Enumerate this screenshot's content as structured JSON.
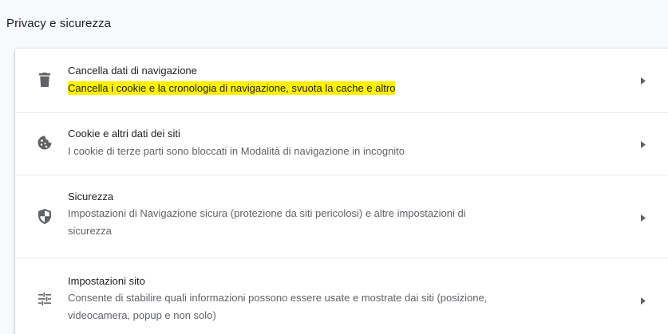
{
  "section": {
    "title": "Privacy e sicurezza"
  },
  "rows": [
    {
      "title": "Cancella dati di navigazione",
      "subtitle": "Cancella i cookie e la cronologia di navigazione, svuota la cache e altro",
      "icon": "trash-icon",
      "highlighted": true
    },
    {
      "title": "Cookie e altri dati dei siti",
      "subtitle": "I cookie di terze parti sono bloccati in Modalità di navigazione in incognito",
      "icon": "cookie-icon"
    },
    {
      "title": "Sicurezza",
      "subtitle_line1": "Impostazioni di Navigazione sicura (protezione da siti pericolosi) e altre impostazioni di",
      "subtitle_line2": "sicurezza",
      "icon": "shield-icon"
    },
    {
      "title": "Impostazioni sito",
      "subtitle_line1": "Consente di stabilire quali informazioni possono essere usate e mostrate dai siti (posizione,",
      "subtitle_line2": "videocamera, popup e non solo)",
      "icon": "tune-icon"
    }
  ],
  "colors": {
    "highlight": "#fff200",
    "icon": "#5f6368",
    "text": "#202124",
    "secondary_text": "#5f6368"
  }
}
